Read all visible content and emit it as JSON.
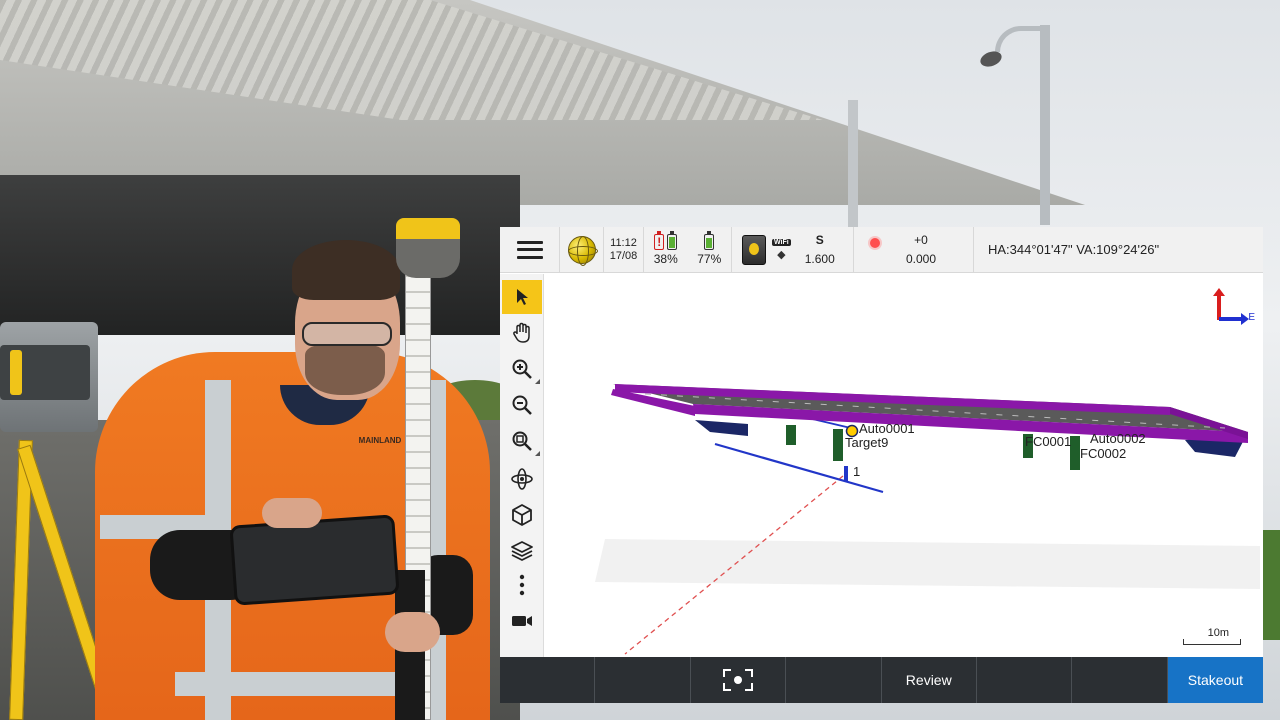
{
  "status_bar": {
    "time": "11:12",
    "date": "17/08",
    "battery_controller": "38%",
    "battery_receiver": "77%",
    "wifi_badge": "WiFi",
    "instrument_face": "S",
    "target_height": "1.600",
    "prism_offset": "+0",
    "offset_value": "0.000",
    "angles": "HA:344°01'47\"  VA:109°24'26\""
  },
  "toolbar": {
    "tools": [
      "select",
      "pan",
      "zoom-in",
      "zoom-out",
      "zoom-extents",
      "orbit",
      "view-3d",
      "layers",
      "more",
      "video"
    ]
  },
  "map": {
    "north_label": "",
    "east_label": "E",
    "scale_label": "10m",
    "points": {
      "auto1": "Auto0001",
      "target9": "Target9",
      "fc1": "FC0001",
      "auto2": "Auto0002",
      "fc2": "FC0002",
      "one": "1"
    },
    "colors": {
      "deck": "#8a17a8",
      "deck_top": "#5a5a5a",
      "pier": "#1f5e2a",
      "line": "#2236c8",
      "sight": "#e05050"
    }
  },
  "bottom_bar": {
    "buttons": [
      "",
      "",
      "",
      "",
      "Review",
      "",
      "",
      "Stakeout"
    ]
  }
}
